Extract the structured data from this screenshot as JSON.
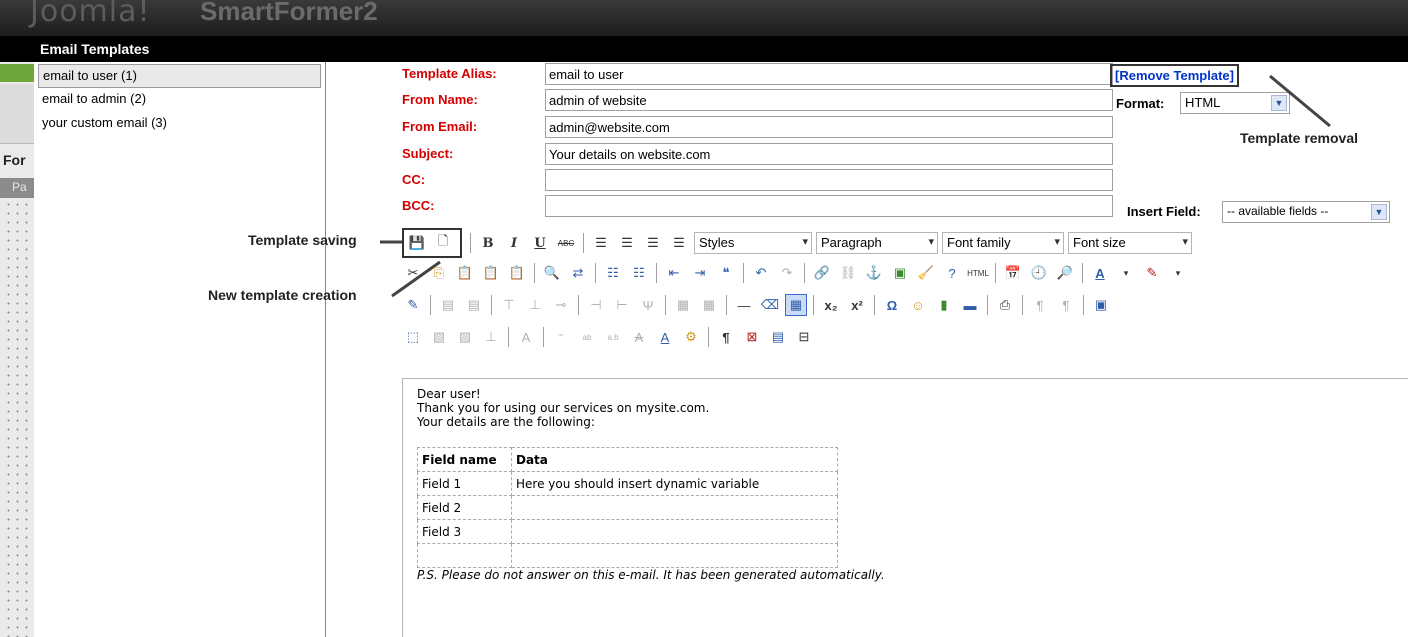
{
  "background": {
    "logo_text": "Joomla!",
    "app_name": "SmartFormer2",
    "left_tab": "For",
    "left_subtab": "Pa"
  },
  "dialog": {
    "title": "Email Templates"
  },
  "templates": [
    {
      "label": "email to user (1)",
      "selected": true
    },
    {
      "label": "email to admin (2)",
      "selected": false
    },
    {
      "label": "your custom email (3)",
      "selected": false
    }
  ],
  "form": {
    "alias_label": "Template Alias:",
    "alias_value": "email to user",
    "from_name_label": "From Name:",
    "from_name_value": "admin of website",
    "from_email_label": "From Email:",
    "from_email_value": "admin@website.com",
    "subject_label": "Subject:",
    "subject_value": "Your details on website.com",
    "cc_label": "CC:",
    "cc_value": "",
    "bcc_label": "BCC:",
    "bcc_value": ""
  },
  "remove_template": "[Remove Template]",
  "format": {
    "label": "Format:",
    "value": "HTML"
  },
  "insert_field": {
    "label": "Insert Field:",
    "value": "-- available fields --"
  },
  "annotations": {
    "template_removal": "Template removal",
    "template_saving": "Template saving",
    "new_template": "New template creation"
  },
  "editor_selects": {
    "styles": "Styles",
    "format": "Paragraph",
    "font_family": "Font family",
    "font_size": "Font size"
  },
  "editor_buttons": {
    "bold": "B",
    "italic": "I",
    "underline": "U",
    "strike": "ABC",
    "html": "HTML"
  },
  "body": {
    "line1": "Dear user!",
    "line2": "Thank you for using our services on mysite.com.",
    "line3": "Your details are the following:",
    "table": {
      "headers": [
        "Field name",
        "Data"
      ],
      "rows": [
        [
          "Field 1",
          "Here you should insert dynamic variable"
        ],
        [
          "Field 2",
          ""
        ],
        [
          "Field 3",
          ""
        ],
        [
          "",
          ""
        ]
      ]
    },
    "ps": "P.S. Please do not answer on this e-mail. It has been generated automatically."
  }
}
